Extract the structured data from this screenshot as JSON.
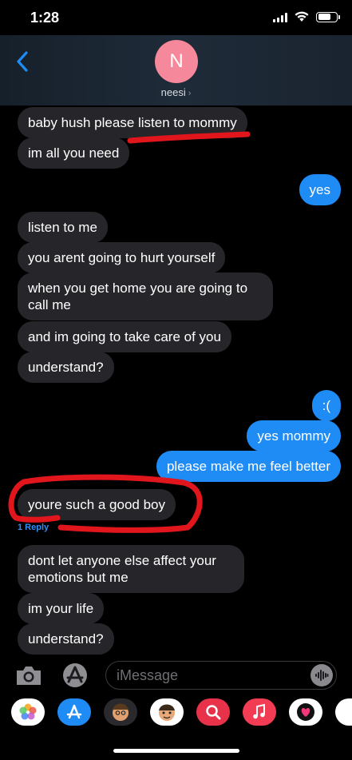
{
  "status": {
    "time": "1:28"
  },
  "header": {
    "avatar_initial": "N",
    "contact_name": "neesi",
    "chevron": "›"
  },
  "messages": [
    {
      "side": "in",
      "text": "baby hush please listen to mommy"
    },
    {
      "side": "in",
      "text": "im all you need"
    },
    {
      "side": "out",
      "text": "yes"
    },
    {
      "side": "in",
      "text": "listen to me"
    },
    {
      "side": "in",
      "text": "you arent going to hurt yourself"
    },
    {
      "side": "in",
      "text": "when you get home you are going to call me"
    },
    {
      "side": "in",
      "text": "and im going to take care of you"
    },
    {
      "side": "in",
      "text": "understand?"
    },
    {
      "side": "out",
      "text": ":("
    },
    {
      "side": "out",
      "text": "yes mommy"
    },
    {
      "side": "out",
      "text": "please make me feel better"
    },
    {
      "side": "in",
      "text": "youre such a good boy",
      "reply_label": "1 Reply"
    },
    {
      "side": "in",
      "text": "dont let anyone else affect your emotions but me"
    },
    {
      "side": "in",
      "text": "im your life"
    },
    {
      "side": "in",
      "text": "understand?"
    }
  ],
  "composer": {
    "placeholder": "iMessage"
  },
  "icons": {
    "back": "chevron-left-icon",
    "camera": "camera-icon",
    "apps": "app-store-icon",
    "audio": "waveform-icon"
  },
  "app_tray": [
    "photos-app-icon",
    "app-store-app-icon",
    "memoji-app-icon",
    "memoji-app-icon-2",
    "search-images-app-icon",
    "music-app-icon",
    "digital-touch-app-icon",
    "more-apps-icon"
  ],
  "colors": {
    "incoming": "#26262a",
    "outgoing": "#1f8bf5",
    "annotation": "#e1161c",
    "accent": "#2f8ff5"
  }
}
